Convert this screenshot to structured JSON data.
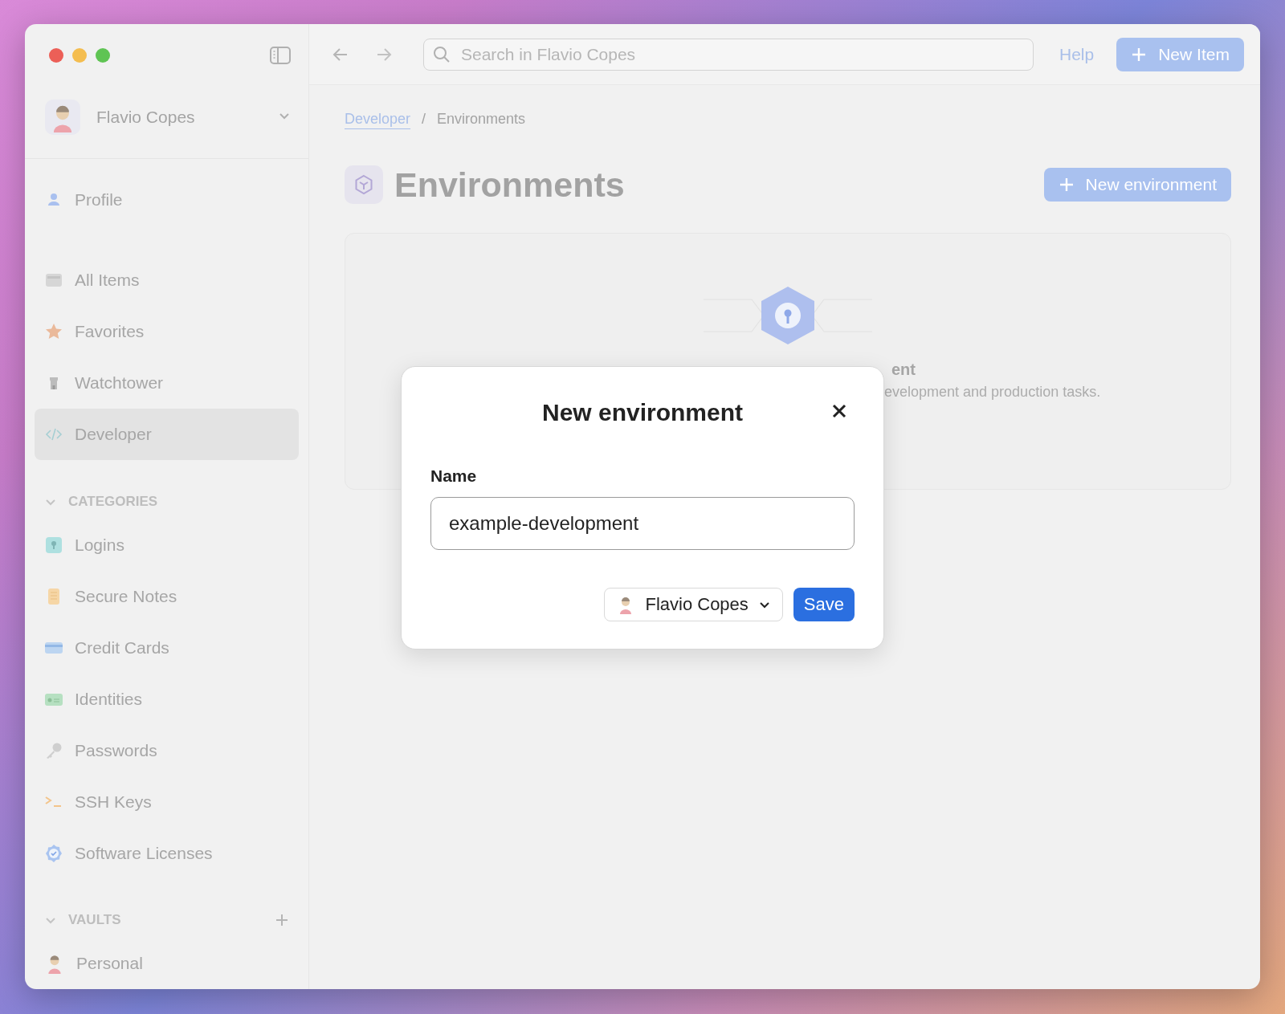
{
  "account": {
    "name": "Flavio Copes"
  },
  "sidebar": {
    "top": [
      {
        "label": "Profile",
        "selected": false
      }
    ],
    "main": [
      {
        "label": "All Items",
        "selected": false
      },
      {
        "label": "Favorites",
        "selected": false
      },
      {
        "label": "Watchtower",
        "selected": false
      },
      {
        "label": "Developer",
        "selected": true
      }
    ],
    "categories": {
      "title": "CATEGORIES",
      "expanded": true,
      "items": [
        {
          "label": "Logins"
        },
        {
          "label": "Secure Notes"
        },
        {
          "label": "Credit Cards"
        },
        {
          "label": "Identities"
        },
        {
          "label": "Passwords"
        },
        {
          "label": "SSH Keys"
        },
        {
          "label": "Software Licenses"
        }
      ]
    },
    "vaults": {
      "title": "VAULTS",
      "expanded": true,
      "items": [
        {
          "label": "Personal"
        }
      ]
    }
  },
  "toolbar": {
    "search": {
      "placeholder": "Search in Flavio Copes"
    },
    "help": "Help",
    "new_item": "New Item"
  },
  "breadcrumb": [
    {
      "label": "Developer",
      "kind": "link"
    },
    {
      "label": "/",
      "kind": "separator"
    },
    {
      "label": "Environments",
      "kind": "current"
    }
  ],
  "page": {
    "title": "Environments",
    "new_button": "New environment",
    "empty_title": "ent",
    "empty_text": "evelopment and production tasks."
  },
  "dialog": {
    "title": "New environment",
    "field_label": "Name",
    "field_value": "example-development",
    "vault": "Flavio Copes",
    "save": "Save"
  }
}
